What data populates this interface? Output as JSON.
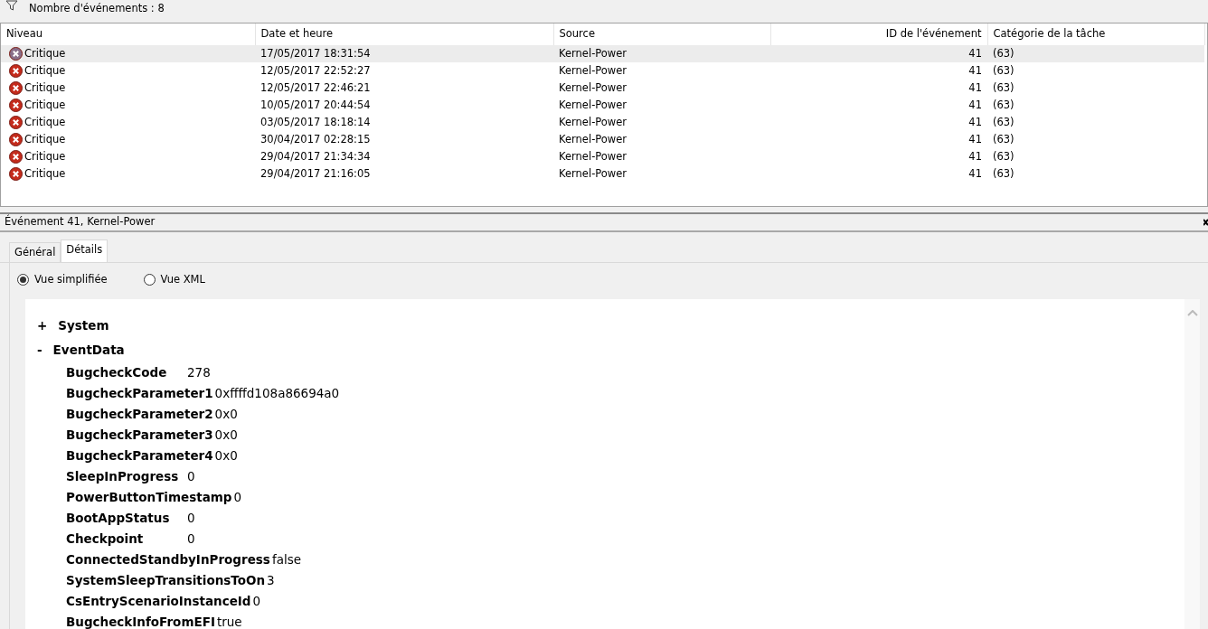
{
  "toolbar": {
    "count_text": "Nombre d'événements : 8"
  },
  "table": {
    "columns": [
      "Niveau",
      "Date et heure",
      "Source",
      "ID de l'événement",
      "Catégorie de la tâche"
    ],
    "rows": [
      {
        "level": "Critique",
        "date": "17/05/2017 18:31:54",
        "source": "Kernel-Power",
        "event_id": "41",
        "category": "(63)",
        "selected": true
      },
      {
        "level": "Critique",
        "date": "12/05/2017 22:52:27",
        "source": "Kernel-Power",
        "event_id": "41",
        "category": "(63)",
        "selected": false
      },
      {
        "level": "Critique",
        "date": "12/05/2017 22:46:21",
        "source": "Kernel-Power",
        "event_id": "41",
        "category": "(63)",
        "selected": false
      },
      {
        "level": "Critique",
        "date": "10/05/2017 20:44:54",
        "source": "Kernel-Power",
        "event_id": "41",
        "category": "(63)",
        "selected": false
      },
      {
        "level": "Critique",
        "date": "03/05/2017 18:18:14",
        "source": "Kernel-Power",
        "event_id": "41",
        "category": "(63)",
        "selected": false
      },
      {
        "level": "Critique",
        "date": "30/04/2017 02:28:15",
        "source": "Kernel-Power",
        "event_id": "41",
        "category": "(63)",
        "selected": false
      },
      {
        "level": "Critique",
        "date": "29/04/2017 21:34:34",
        "source": "Kernel-Power",
        "event_id": "41",
        "category": "(63)",
        "selected": false
      },
      {
        "level": "Critique",
        "date": "29/04/2017 21:16:05",
        "source": "Kernel-Power",
        "event_id": "41",
        "category": "(63)",
        "selected": false
      }
    ]
  },
  "detail": {
    "title": "Événement 41, Kernel-Power",
    "tabs": [
      {
        "label": "Général",
        "selected": false
      },
      {
        "label": "Détails",
        "selected": true
      }
    ],
    "views": [
      {
        "label": "Vue simplifiée",
        "selected": true
      },
      {
        "label": "Vue XML",
        "selected": false
      }
    ],
    "tree": [
      {
        "toggle": "+",
        "label": "System"
      },
      {
        "toggle": "-",
        "label": "EventData",
        "children": [
          {
            "name": "BugcheckCode",
            "value": "278"
          },
          {
            "name": "BugcheckParameter1",
            "value": "0xffffd108a86694a0"
          },
          {
            "name": "BugcheckParameter2",
            "value": "0x0"
          },
          {
            "name": "BugcheckParameter3",
            "value": "0x0"
          },
          {
            "name": "BugcheckParameter4",
            "value": "0x0"
          },
          {
            "name": "SleepInProgress",
            "value": "0"
          },
          {
            "name": "PowerButtonTimestamp",
            "value": "0"
          },
          {
            "name": "BootAppStatus",
            "value": "0"
          },
          {
            "name": "Checkpoint",
            "value": "0"
          },
          {
            "name": "ConnectedStandbyInProgress",
            "value": "false"
          },
          {
            "name": "SystemSleepTransitionsToOn",
            "value": "3"
          },
          {
            "name": "CsEntryScenarioInstanceId",
            "value": "0"
          },
          {
            "name": "BugcheckInfoFromEFI",
            "value": "true"
          }
        ]
      }
    ]
  }
}
